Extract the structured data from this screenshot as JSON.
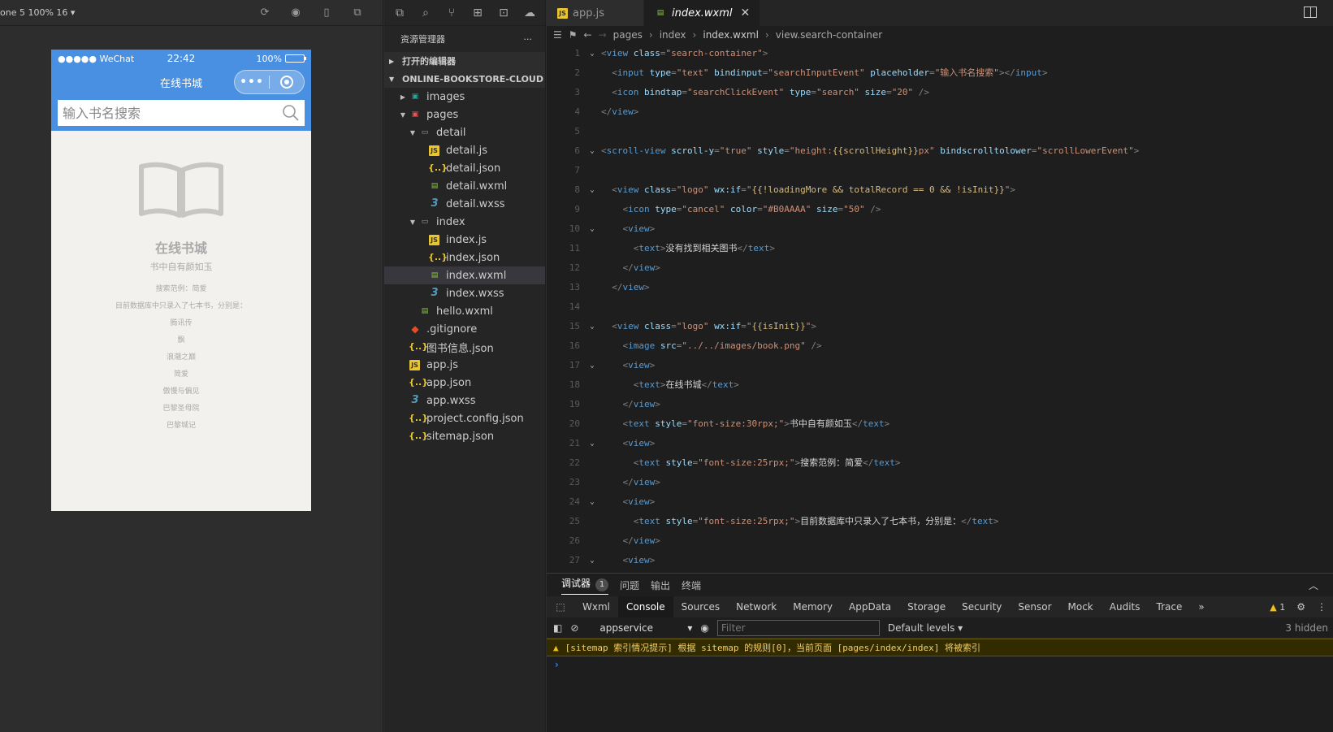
{
  "simulator": {
    "device_label": "one 5 100% 16 ▾",
    "status": {
      "carrier": "●●●●● WeChat",
      "time": "22:42",
      "battery": "100%"
    },
    "nav_title": "在线书城",
    "capsule_dots": "•••",
    "search_placeholder": "输入书名搜索",
    "logo_title": "在线书城",
    "logo_sub": "书中自有颜如玉",
    "example": "搜索范例：简爱",
    "intro": "目前数据库中只录入了七本书，分别是：",
    "books": [
      "腾讯传",
      "飘",
      "浪潮之巅",
      "简爱",
      "傲慢与偏见",
      "巴黎圣母院",
      "巴黎城记"
    ]
  },
  "explorer": {
    "title": "资源管理器",
    "more": "···",
    "open_editors": "打开的编辑器",
    "project": "ONLINE-BOOKSTORE-CLOUD",
    "tree": [
      {
        "label": "images",
        "depth": 1,
        "twisty": "▶",
        "icon": "folder-img",
        "glyph": "▣",
        "name": "folder-images"
      },
      {
        "label": "pages",
        "depth": 1,
        "twisty": "▼",
        "icon": "folder-pages",
        "glyph": "▣",
        "name": "folder-pages"
      },
      {
        "label": "detail",
        "depth": 2,
        "twisty": "▼",
        "icon": "folder",
        "glyph": "▭",
        "name": "folder-detail"
      },
      {
        "label": "detail.js",
        "depth": 3,
        "twisty": "",
        "icon": "js",
        "glyph": "JS",
        "name": "file-detail-js"
      },
      {
        "label": "detail.json",
        "depth": 3,
        "twisty": "",
        "icon": "json",
        "glyph": "{..}",
        "name": "file-detail-json"
      },
      {
        "label": "detail.wxml",
        "depth": 3,
        "twisty": "",
        "icon": "wxml",
        "glyph": "▤",
        "name": "file-detail-wxml"
      },
      {
        "label": "detail.wxss",
        "depth": 3,
        "twisty": "",
        "icon": "wxss",
        "glyph": "3",
        "name": "file-detail-wxss"
      },
      {
        "label": "index",
        "depth": 2,
        "twisty": "▼",
        "icon": "folder",
        "glyph": "▭",
        "name": "folder-index"
      },
      {
        "label": "index.js",
        "depth": 3,
        "twisty": "",
        "icon": "js",
        "glyph": "JS",
        "name": "file-index-js"
      },
      {
        "label": "index.json",
        "depth": 3,
        "twisty": "",
        "icon": "json",
        "glyph": "{..}",
        "name": "file-index-json"
      },
      {
        "label": "index.wxml",
        "depth": 3,
        "twisty": "",
        "icon": "wxml",
        "glyph": "▤",
        "name": "file-index-wxml",
        "selected": true
      },
      {
        "label": "index.wxss",
        "depth": 3,
        "twisty": "",
        "icon": "wxss",
        "glyph": "3",
        "name": "file-index-wxss"
      },
      {
        "label": "hello.wxml",
        "depth": 2,
        "twisty": "",
        "icon": "wxml",
        "glyph": "▤",
        "name": "file-hello-wxml"
      },
      {
        "label": ".gitignore",
        "depth": 1,
        "twisty": "",
        "icon": "git",
        "glyph": "◆",
        "name": "file-gitignore"
      },
      {
        "label": "图书信息.json",
        "depth": 1,
        "twisty": "",
        "icon": "json",
        "glyph": "{..}",
        "name": "file-books-json"
      },
      {
        "label": "app.js",
        "depth": 1,
        "twisty": "",
        "icon": "js",
        "glyph": "JS",
        "name": "file-app-js"
      },
      {
        "label": "app.json",
        "depth": 1,
        "twisty": "",
        "icon": "json",
        "glyph": "{..}",
        "name": "file-app-json"
      },
      {
        "label": "app.wxss",
        "depth": 1,
        "twisty": "",
        "icon": "wxss",
        "glyph": "3",
        "name": "file-app-wxss"
      },
      {
        "label": "project.config.json",
        "depth": 1,
        "twisty": "",
        "icon": "json",
        "glyph": "{..}",
        "name": "file-project-config"
      },
      {
        "label": "sitemap.json",
        "depth": 1,
        "twisty": "",
        "icon": "json",
        "glyph": "{..}",
        "name": "file-sitemap"
      }
    ]
  },
  "editor": {
    "tabs": [
      {
        "label": "app.js",
        "icon": "JS",
        "active": false
      },
      {
        "label": "index.wxml",
        "icon": "▤",
        "active": true,
        "close": "✕"
      }
    ],
    "breadcrumb": [
      "pages",
      "index",
      "index.wxml",
      "view.search-container"
    ],
    "lines": [
      {
        "n": "1",
        "fold": "⌄",
        "indent": "",
        "tokens": [
          [
            "p",
            "<"
          ],
          [
            "t",
            "view"
          ],
          [
            "a",
            " class"
          ],
          [
            "p",
            "="
          ],
          [
            "v",
            "\"search-container\""
          ],
          [
            "p",
            ">"
          ]
        ]
      },
      {
        "n": "2",
        "fold": "",
        "indent": "  ",
        "tokens": [
          [
            "p",
            "<"
          ],
          [
            "t",
            "input"
          ],
          [
            "a",
            " type"
          ],
          [
            "p",
            "="
          ],
          [
            "v",
            "\"text\""
          ],
          [
            "a",
            " bindinput"
          ],
          [
            "p",
            "="
          ],
          [
            "v",
            "\"searchInputEvent\""
          ],
          [
            "a",
            " placeholder"
          ],
          [
            "p",
            "="
          ],
          [
            "v",
            "\"输入书名搜索\""
          ],
          [
            "p",
            "></"
          ],
          [
            "t",
            "input"
          ],
          [
            "p",
            ">"
          ]
        ]
      },
      {
        "n": "3",
        "fold": "",
        "indent": "  ",
        "tokens": [
          [
            "p",
            "<"
          ],
          [
            "t",
            "icon"
          ],
          [
            "a",
            " bindtap"
          ],
          [
            "p",
            "="
          ],
          [
            "v",
            "\"searchClickEvent\""
          ],
          [
            "a",
            " type"
          ],
          [
            "p",
            "="
          ],
          [
            "v",
            "\"search\""
          ],
          [
            "a",
            " size"
          ],
          [
            "p",
            "="
          ],
          [
            "v",
            "\"20\""
          ],
          [
            "p",
            " />"
          ]
        ]
      },
      {
        "n": "4",
        "fold": "",
        "indent": "",
        "tokens": [
          [
            "p",
            "</"
          ],
          [
            "t",
            "view"
          ],
          [
            "p",
            ">"
          ]
        ]
      },
      {
        "n": "5",
        "fold": "",
        "indent": "",
        "tokens": []
      },
      {
        "n": "6",
        "fold": "⌄",
        "indent": "",
        "tokens": [
          [
            "p",
            "<"
          ],
          [
            "t",
            "scroll-view"
          ],
          [
            "a",
            " scroll-y"
          ],
          [
            "p",
            "="
          ],
          [
            "v",
            "\"true\""
          ],
          [
            "a",
            " style"
          ],
          [
            "p",
            "="
          ],
          [
            "v",
            "\"height:"
          ],
          [
            "e",
            "{{scrollHeight}}"
          ],
          [
            "v",
            "px\""
          ],
          [
            "a",
            " bindscrolltolower"
          ],
          [
            "p",
            "="
          ],
          [
            "v",
            "\"scrollLowerEvent\""
          ],
          [
            "p",
            ">"
          ]
        ]
      },
      {
        "n": "7",
        "fold": "",
        "indent": "",
        "tokens": []
      },
      {
        "n": "8",
        "fold": "⌄",
        "indent": "  ",
        "tokens": [
          [
            "p",
            "<"
          ],
          [
            "t",
            "view"
          ],
          [
            "a",
            " class"
          ],
          [
            "p",
            "="
          ],
          [
            "v",
            "\"logo\""
          ],
          [
            "a",
            " wx:if"
          ],
          [
            "p",
            "="
          ],
          [
            "v",
            "\""
          ],
          [
            "e",
            "{{!loadingMore && totalRecord == 0 && !isInit}}"
          ],
          [
            "v",
            "\""
          ],
          [
            "p",
            ">"
          ]
        ]
      },
      {
        "n": "9",
        "fold": "",
        "indent": "    ",
        "tokens": [
          [
            "p",
            "<"
          ],
          [
            "t",
            "icon"
          ],
          [
            "a",
            " type"
          ],
          [
            "p",
            "="
          ],
          [
            "v",
            "\"cancel\""
          ],
          [
            "a",
            " color"
          ],
          [
            "p",
            "="
          ],
          [
            "v",
            "\"#B0AAAA\""
          ],
          [
            "a",
            " size"
          ],
          [
            "p",
            "="
          ],
          [
            "v",
            "\"50\""
          ],
          [
            "p",
            " />"
          ]
        ]
      },
      {
        "n": "10",
        "fold": "⌄",
        "indent": "    ",
        "tokens": [
          [
            "p",
            "<"
          ],
          [
            "t",
            "view"
          ],
          [
            "p",
            ">"
          ]
        ]
      },
      {
        "n": "11",
        "fold": "",
        "indent": "      ",
        "tokens": [
          [
            "p",
            "<"
          ],
          [
            "t",
            "text"
          ],
          [
            "p",
            ">"
          ],
          [
            "txt",
            "没有找到相关图书"
          ],
          [
            "p",
            "</"
          ],
          [
            "t",
            "text"
          ],
          [
            "p",
            ">"
          ]
        ]
      },
      {
        "n": "12",
        "fold": "",
        "indent": "    ",
        "tokens": [
          [
            "p",
            "</"
          ],
          [
            "t",
            "view"
          ],
          [
            "p",
            ">"
          ]
        ]
      },
      {
        "n": "13",
        "fold": "",
        "indent": "  ",
        "tokens": [
          [
            "p",
            "</"
          ],
          [
            "t",
            "view"
          ],
          [
            "p",
            ">"
          ]
        ]
      },
      {
        "n": "14",
        "fold": "",
        "indent": "",
        "tokens": []
      },
      {
        "n": "15",
        "fold": "⌄",
        "indent": "  ",
        "tokens": [
          [
            "p",
            "<"
          ],
          [
            "t",
            "view"
          ],
          [
            "a",
            " class"
          ],
          [
            "p",
            "="
          ],
          [
            "v",
            "\"logo\""
          ],
          [
            "a",
            " wx:if"
          ],
          [
            "p",
            "="
          ],
          [
            "v",
            "\""
          ],
          [
            "e",
            "{{isInit}}"
          ],
          [
            "v",
            "\""
          ],
          [
            "p",
            ">"
          ]
        ]
      },
      {
        "n": "16",
        "fold": "",
        "indent": "    ",
        "tokens": [
          [
            "p",
            "<"
          ],
          [
            "t",
            "image"
          ],
          [
            "a",
            " src"
          ],
          [
            "p",
            "="
          ],
          [
            "v",
            "\"../../images/book.png\""
          ],
          [
            "p",
            " />"
          ]
        ]
      },
      {
        "n": "17",
        "fold": "⌄",
        "indent": "    ",
        "tokens": [
          [
            "p",
            "<"
          ],
          [
            "t",
            "view"
          ],
          [
            "p",
            ">"
          ]
        ]
      },
      {
        "n": "18",
        "fold": "",
        "indent": "      ",
        "tokens": [
          [
            "p",
            "<"
          ],
          [
            "t",
            "text"
          ],
          [
            "p",
            ">"
          ],
          [
            "txt",
            "在线书城"
          ],
          [
            "p",
            "</"
          ],
          [
            "t",
            "text"
          ],
          [
            "p",
            ">"
          ]
        ]
      },
      {
        "n": "19",
        "fold": "",
        "indent": "    ",
        "tokens": [
          [
            "p",
            "</"
          ],
          [
            "t",
            "view"
          ],
          [
            "p",
            ">"
          ]
        ]
      },
      {
        "n": "20",
        "fold": "",
        "indent": "    ",
        "tokens": [
          [
            "p",
            "<"
          ],
          [
            "t",
            "text"
          ],
          [
            "a",
            " style"
          ],
          [
            "p",
            "="
          ],
          [
            "v",
            "\"font-size:30rpx;\""
          ],
          [
            "p",
            ">"
          ],
          [
            "txt",
            "书中自有颜如玉"
          ],
          [
            "p",
            "</"
          ],
          [
            "t",
            "text"
          ],
          [
            "p",
            ">"
          ]
        ]
      },
      {
        "n": "21",
        "fold": "⌄",
        "indent": "    ",
        "tokens": [
          [
            "p",
            "<"
          ],
          [
            "t",
            "view"
          ],
          [
            "p",
            ">"
          ]
        ]
      },
      {
        "n": "22",
        "fold": "",
        "indent": "      ",
        "tokens": [
          [
            "p",
            "<"
          ],
          [
            "t",
            "text"
          ],
          [
            "a",
            " style"
          ],
          [
            "p",
            "="
          ],
          [
            "v",
            "\"font-size:25rpx;\""
          ],
          [
            "p",
            ">"
          ],
          [
            "txt",
            "搜索范例：简爱"
          ],
          [
            "p",
            "</"
          ],
          [
            "t",
            "text"
          ],
          [
            "p",
            ">"
          ]
        ]
      },
      {
        "n": "23",
        "fold": "",
        "indent": "    ",
        "tokens": [
          [
            "p",
            "</"
          ],
          [
            "t",
            "view"
          ],
          [
            "p",
            ">"
          ]
        ]
      },
      {
        "n": "24",
        "fold": "⌄",
        "indent": "    ",
        "tokens": [
          [
            "p",
            "<"
          ],
          [
            "t",
            "view"
          ],
          [
            "p",
            ">"
          ]
        ]
      },
      {
        "n": "25",
        "fold": "",
        "indent": "      ",
        "tokens": [
          [
            "p",
            "<"
          ],
          [
            "t",
            "text"
          ],
          [
            "a",
            " style"
          ],
          [
            "p",
            "="
          ],
          [
            "v",
            "\"font-size:25rpx;\""
          ],
          [
            "p",
            ">"
          ],
          [
            "txt",
            "目前数据库中只录入了七本书，分别是："
          ],
          [
            "p",
            "</"
          ],
          [
            "t",
            "text"
          ],
          [
            "p",
            ">"
          ]
        ]
      },
      {
        "n": "26",
        "fold": "",
        "indent": "    ",
        "tokens": [
          [
            "p",
            "</"
          ],
          [
            "t",
            "view"
          ],
          [
            "p",
            ">"
          ]
        ]
      },
      {
        "n": "27",
        "fold": "⌄",
        "indent": "    ",
        "tokens": [
          [
            "p",
            "<"
          ],
          [
            "t",
            "view"
          ],
          [
            "p",
            ">"
          ]
        ]
      }
    ]
  },
  "debug": {
    "tabs": [
      "调试器",
      "问题",
      "输出",
      "终端"
    ],
    "debugger_count": "1",
    "devtools_tabs": [
      "Wxml",
      "Console",
      "Sources",
      "Network",
      "Memory",
      "AppData",
      "Storage",
      "Security",
      "Sensor",
      "Mock",
      "Audits",
      "Trace"
    ],
    "more": "»",
    "warning_count": "1",
    "context": "appservice",
    "filter_placeholder": "Filter",
    "levels": "Default levels ▾",
    "hidden": "3 hidden",
    "warning_message": "[sitemap 索引情况提示] 根据 sitemap 的规则[0]，当前页面 [pages/index/index] 将被索引",
    "prompt": "›"
  },
  "colors": {
    "wechat_blue": "#4a90e2",
    "editor_bg": "#1e1e1e",
    "warning_bg": "#332b00"
  }
}
